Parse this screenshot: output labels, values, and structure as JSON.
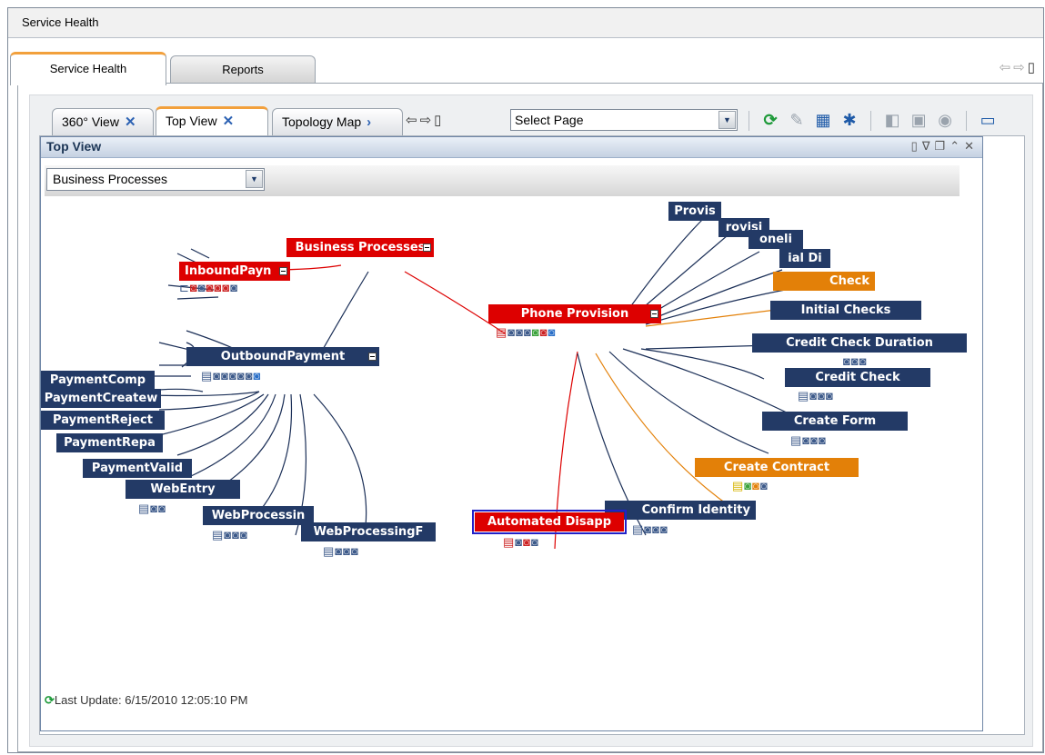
{
  "window": {
    "title": "Service Health"
  },
  "main_tabs": [
    {
      "label": "Service Health",
      "active": true
    },
    {
      "label": "Reports",
      "active": false
    }
  ],
  "sub_tabs": [
    {
      "label": "360° View",
      "close": "✕"
    },
    {
      "label": "Top View",
      "close": "✕",
      "active": true
    },
    {
      "label": "Topology Map",
      "close": "›"
    }
  ],
  "page_select": {
    "value": "Select Page"
  },
  "view": {
    "title": "Top View",
    "dropdown_value": "Business Processes",
    "last_update": "Last Update: 6/15/2010 12:05:10 PM"
  },
  "nodes": {
    "business_processes": "Business Processes",
    "inbound_payment": "InboundPayn",
    "outbound_payment": "OutboundPayment",
    "payment_comp": "PaymentComp",
    "payment_create": "PaymentCreatew",
    "payment_reject": "PaymentReject",
    "payment_repa": "PaymentRepa",
    "payment_valid": "PaymentValid",
    "web_entry": "WebEntry",
    "web_processing": "WebProcessin",
    "web_processing_f": "WebProcessingF",
    "phone_provision": "Phone Provision",
    "provis": "Provis",
    "provisi": "rovisi",
    "oneli": "oneli",
    "ial_di": "ial Di",
    "check": "Check",
    "initial_checks": "Initial Checks",
    "credit_check_duration": "Credit Check Duration",
    "credit_check": "Credit Check",
    "create_form": "Create Form",
    "create_contract": "Create Contract",
    "confirm_identity": "Confirm Identity",
    "automated_disapp": "Automated Disapp"
  },
  "colors": {
    "node_blue": "#233a66",
    "node_red": "#dd0000",
    "node_orange": "#e38008",
    "link_blue": "#1b2f57",
    "link_red": "#dd0000",
    "link_orange": "#e38008",
    "tab_accent": "#f2a03c"
  }
}
